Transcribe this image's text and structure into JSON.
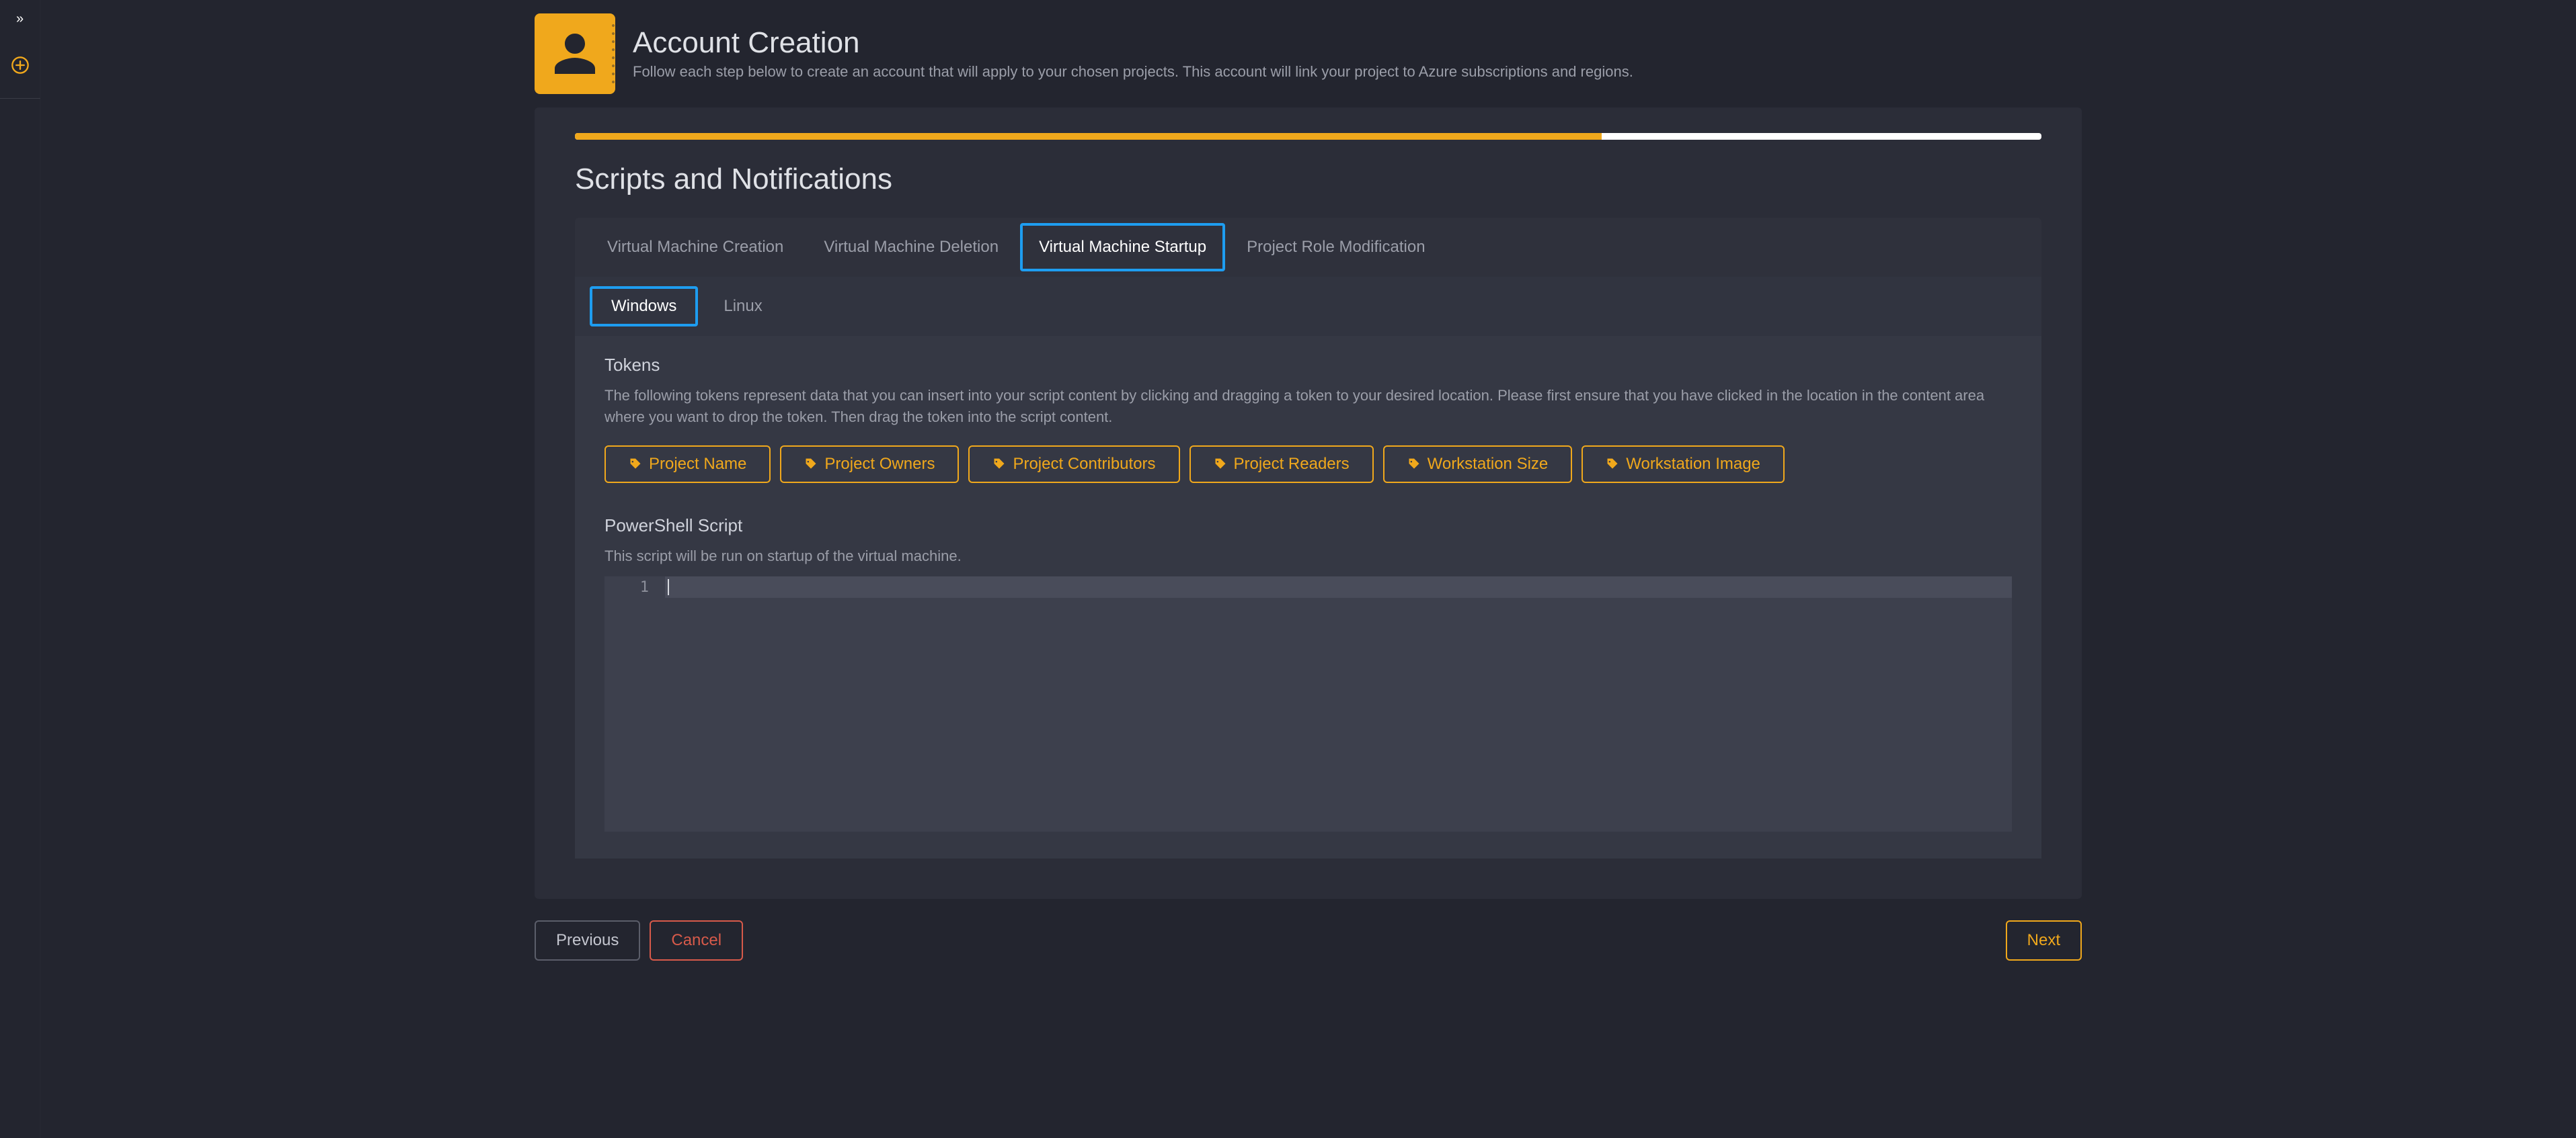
{
  "header": {
    "title": "Account Creation",
    "subtitle": "Follow each step below to create an account that will apply to your chosen projects. This account will link your project to Azure subscriptions and regions."
  },
  "progress": {
    "percent": 70
  },
  "section_title": "Scripts and Notifications",
  "tabs1": {
    "items": [
      {
        "label": "Virtual Machine Creation",
        "active": false
      },
      {
        "label": "Virtual Machine Deletion",
        "active": false
      },
      {
        "label": "Virtual Machine Startup",
        "active": true
      },
      {
        "label": "Project Role Modification",
        "active": false
      }
    ]
  },
  "tabs2": {
    "items": [
      {
        "label": "Windows",
        "active": true
      },
      {
        "label": "Linux",
        "active": false
      }
    ]
  },
  "tokens": {
    "heading": "Tokens",
    "description": "The following tokens represent data that you can insert into your script content by clicking and dragging a token to your desired location. Please first ensure that you have clicked in the location in the content area where you want to drop the token. Then drag the token into the script content.",
    "items": [
      {
        "label": "Project Name"
      },
      {
        "label": "Project Owners"
      },
      {
        "label": "Project Contributors"
      },
      {
        "label": "Project Readers"
      },
      {
        "label": "Workstation Size"
      },
      {
        "label": "Workstation Image"
      }
    ]
  },
  "script": {
    "heading": "PowerShell Script",
    "description": "This script will be run on startup of the virtual machine.",
    "line_number": "1",
    "content": ""
  },
  "footer": {
    "previous": "Previous",
    "cancel": "Cancel",
    "next": "Next"
  },
  "colors": {
    "accent": "#f0a81c",
    "highlight": "#1e9df0",
    "danger": "#d75a4a"
  }
}
